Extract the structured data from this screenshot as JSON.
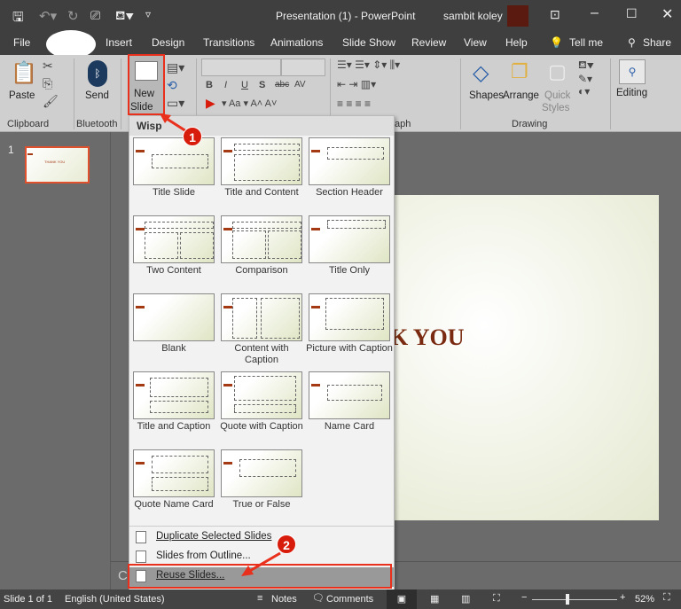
{
  "titlebar": {
    "title": "Presentation (1)  -  PowerPoint",
    "user": "sambit koley"
  },
  "tabs": [
    "File",
    "Insert",
    "Design",
    "Transitions",
    "Animations",
    "Slide Show",
    "Review",
    "View",
    "Help",
    "Tell me",
    "Share"
  ],
  "ribbon": {
    "paste": "Paste",
    "send": "Send",
    "new_slide_1": "New",
    "new_slide_2": "Slide",
    "shapes": "Shapes",
    "arrange": "Arrange",
    "quick_styles_1": "Quick",
    "quick_styles_2": "Styles",
    "editing": "Editing",
    "groups": {
      "clipboard": "Clipboard",
      "bluetooth": "Bluetooth",
      "paragraph": "aph",
      "drawing": "Drawing"
    },
    "font_buttons": [
      "B",
      "I",
      "U",
      "S",
      "abc",
      "AV"
    ]
  },
  "thumbnail": {
    "number": "1",
    "text": "THANK YOU"
  },
  "slide": {
    "text": "K YOU"
  },
  "notes_placeholder": "Cl",
  "menu": {
    "header": "Wisp",
    "layouts": [
      {
        "label": "Title Slide"
      },
      {
        "label": "Title and Content"
      },
      {
        "label": "Section Header"
      },
      {
        "label": "Two Content"
      },
      {
        "label": "Comparison"
      },
      {
        "label": "Title Only"
      },
      {
        "label": "Blank"
      },
      {
        "label": "Content with Caption"
      },
      {
        "label": "Picture with Caption"
      },
      {
        "label": "Title and Caption"
      },
      {
        "label": "Quote with Caption"
      },
      {
        "label": "Name Card"
      },
      {
        "label": "Quote Name Card"
      },
      {
        "label": "True or False"
      }
    ],
    "items": [
      {
        "label": "Duplicate Selected Slides"
      },
      {
        "label": "Slides from Outline..."
      },
      {
        "label": "Reuse Slides..."
      }
    ]
  },
  "annotations": {
    "step1": "1",
    "step2": "2",
    "color": "#e8301c"
  },
  "status": {
    "slide": "Slide 1 of 1",
    "language": "English (United States)",
    "notes": "Notes",
    "comments": "Comments",
    "zoom": "52%",
    "zoom_level": 52
  }
}
